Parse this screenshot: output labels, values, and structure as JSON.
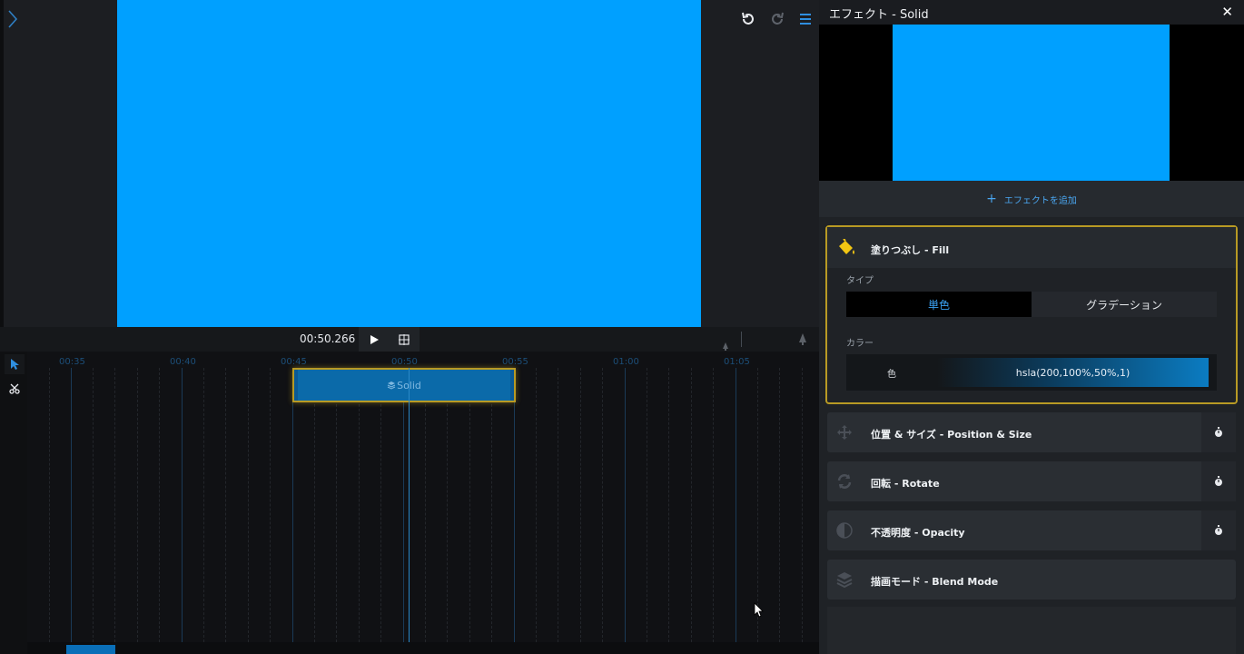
{
  "stage": {
    "preview_color": "#00a0ff",
    "icons": [
      "chevron-right-icon",
      "undo-icon",
      "redo-icon",
      "menu-icon"
    ]
  },
  "timeline": {
    "timecode": "00:50.266",
    "ruler_labels": [
      "00:35",
      "00:40",
      "00:45",
      "00:50",
      "00:55",
      "01:00",
      "01:05"
    ],
    "clip_label": "Solid",
    "tools": [
      "select-tool",
      "cut-tool"
    ]
  },
  "panel": {
    "title": "エフェクト - Solid",
    "close_label": "✕",
    "add_effect_label": "エフェクトを追加",
    "fill": {
      "title": "塗りつぶし - Fill",
      "type_label": "タイプ",
      "type_options": [
        "単色",
        "グラデーション"
      ],
      "type_selected": "単色",
      "color_label": "カラー",
      "color_swatch_label": "色",
      "color_value": "hsla(200,100%,50%,1)"
    },
    "effects": [
      {
        "title": "位置 & サイズ - Position & Size",
        "icon": "move-icon",
        "has_keyframe": true
      },
      {
        "title": "回転 - Rotate",
        "icon": "rotate-icon",
        "has_keyframe": true
      },
      {
        "title": "不透明度 - Opacity",
        "icon": "opacity-icon",
        "has_keyframe": true
      },
      {
        "title": "描画モード - Blend Mode",
        "icon": "layers-icon",
        "has_keyframe": false
      }
    ]
  },
  "colors": {
    "accent_blue": "#00a0ff",
    "highlight_gold": "#b89a24",
    "clip_blue": "#0b6aa9"
  }
}
